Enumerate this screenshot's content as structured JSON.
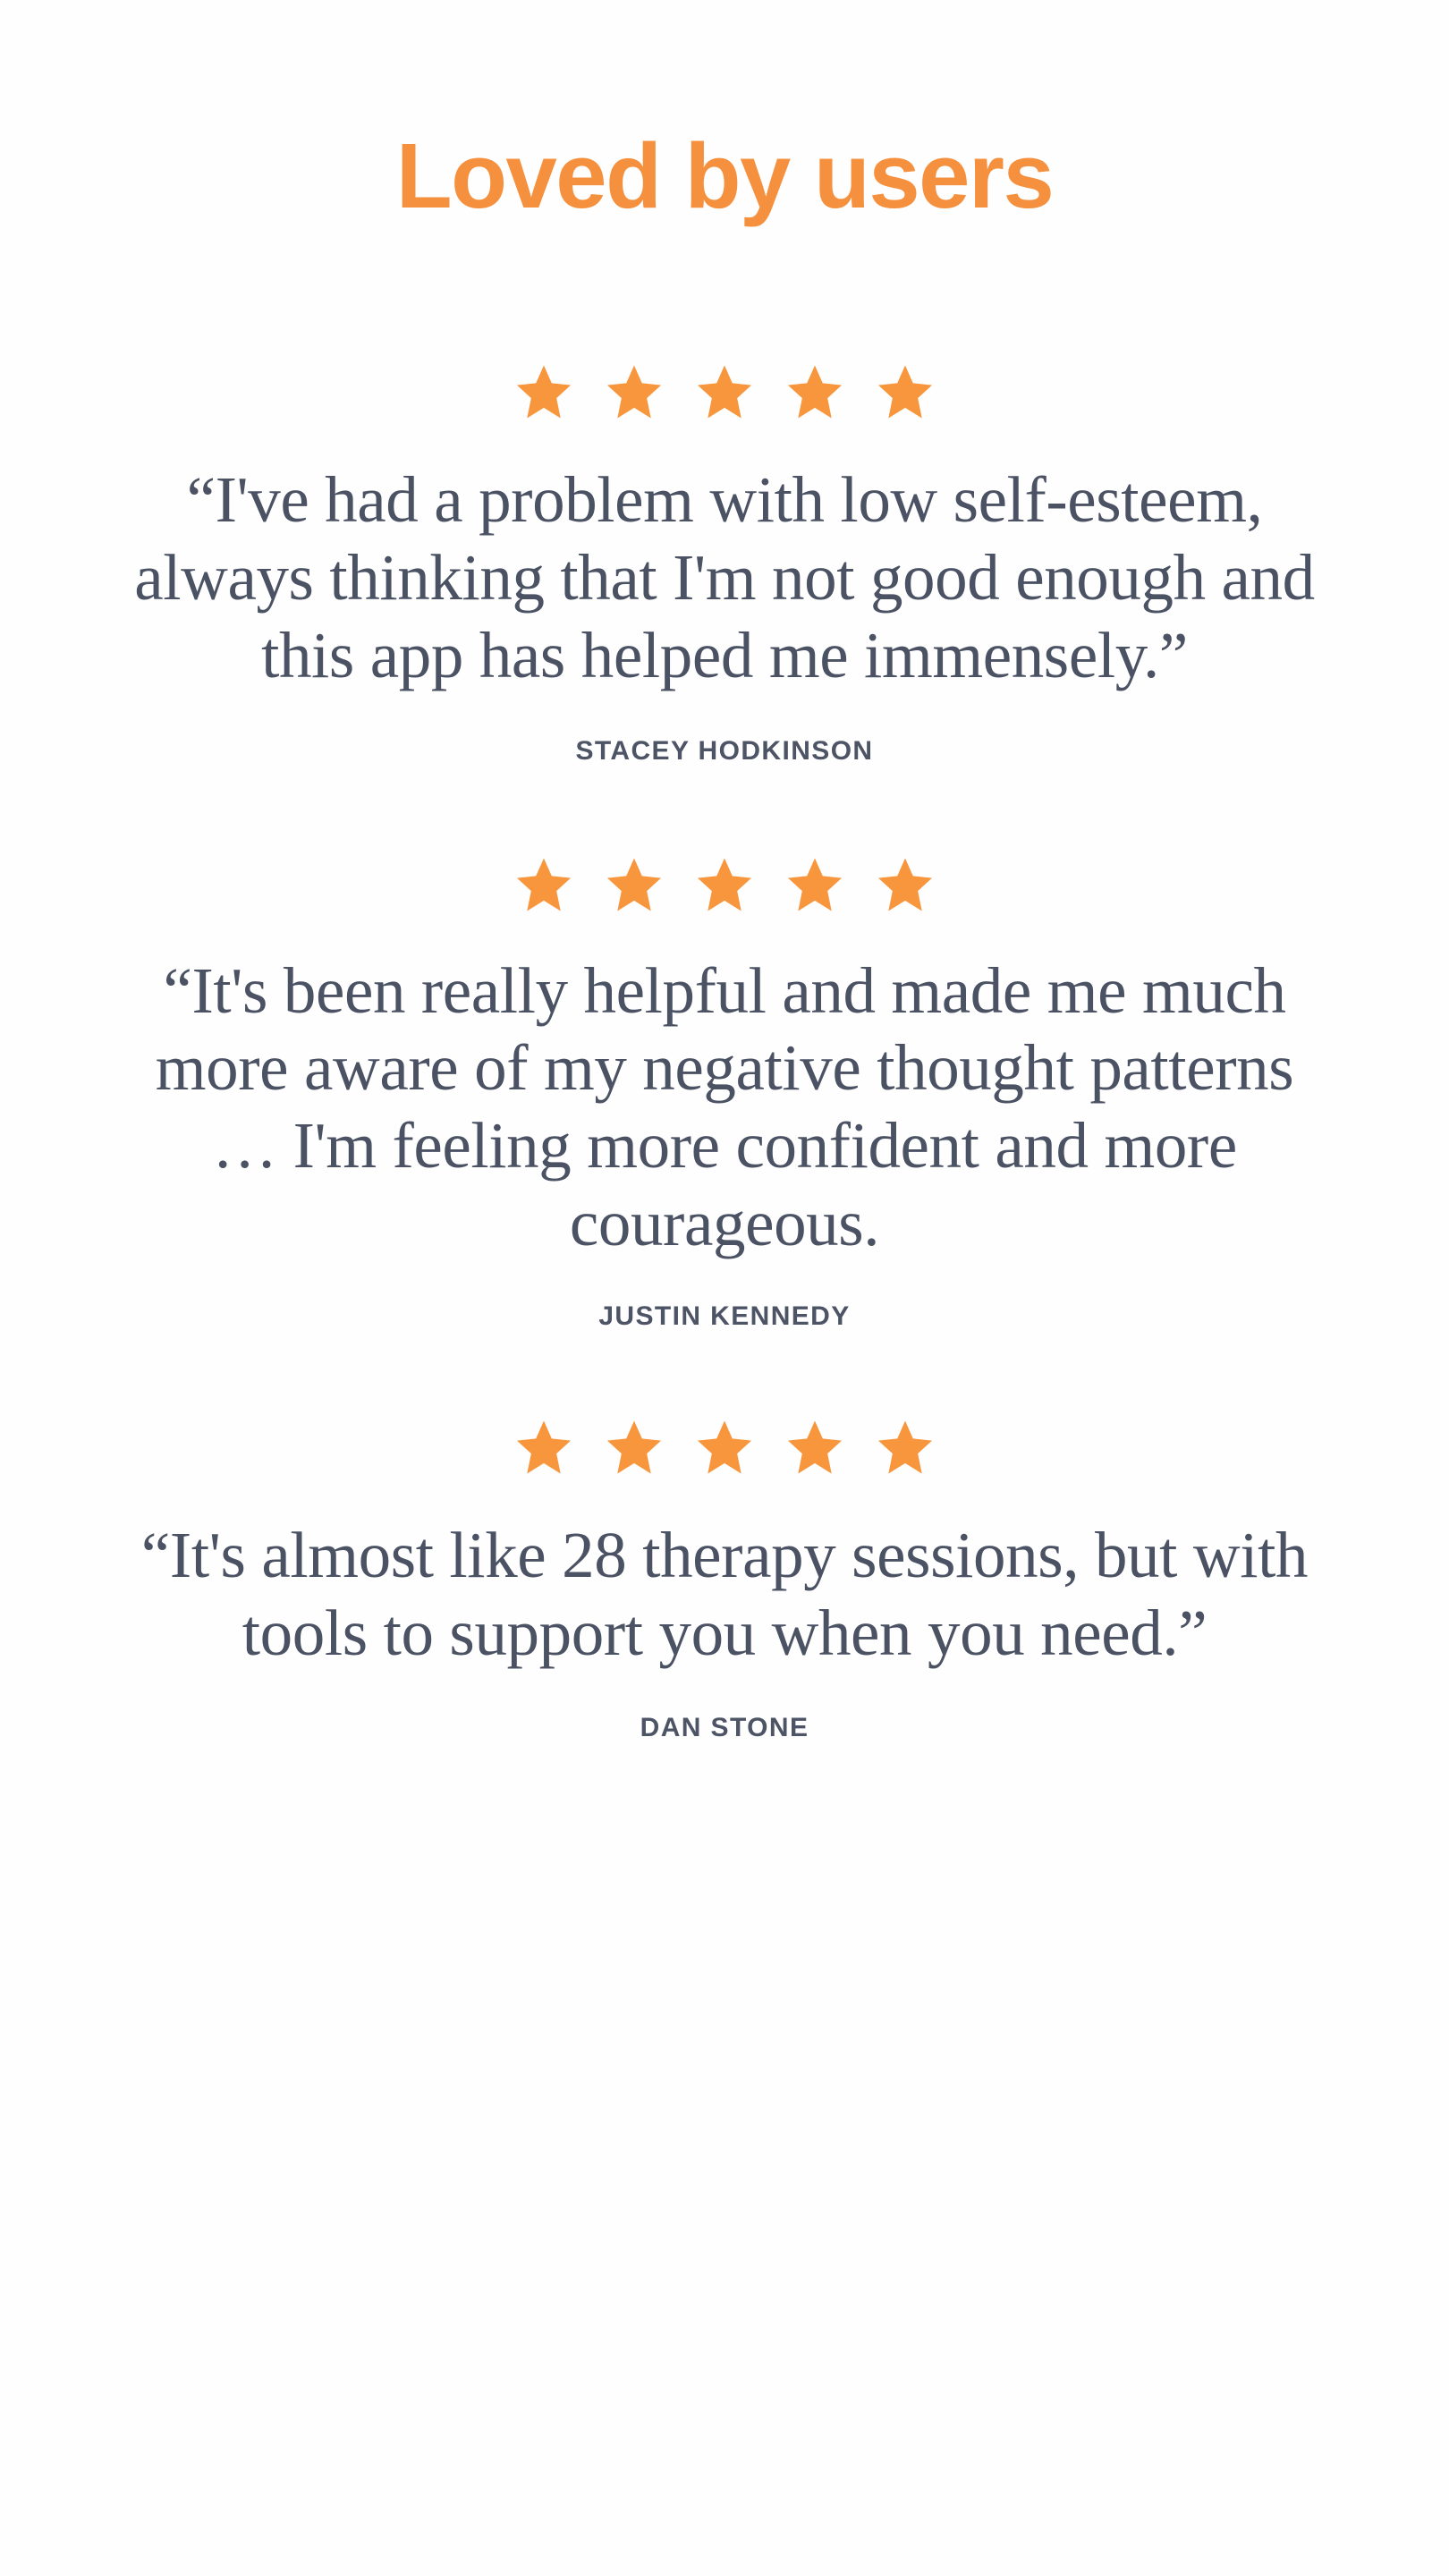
{
  "section": {
    "heading": "Loved by users",
    "accent_color": "#F5913E",
    "star_color": "#F7963C",
    "quote_text_color": "#4A5263",
    "author_text_color": "#4C5465",
    "background_color": "#FFFEFE"
  },
  "stars": {
    "icon_name": "star-icon",
    "count_per_review": 5,
    "rating": 5,
    "max_rating": 5
  },
  "testimonials": [
    {
      "rating": 5,
      "quote": "“I've had a problem with low self-esteem, always thinking that I'm not good enough and this app has helped me immensely.”",
      "author": "STACEY HODKINSON"
    },
    {
      "rating": 5,
      "quote": "“It's been really helpful and made me much more aware of my negative thought patterns … I'm feeling more confident and more courageous.",
      "author": "JUSTIN KENNEDY"
    },
    {
      "rating": 5,
      "quote": "“It's almost like 28 therapy sessions, but with tools to support you when you need.”",
      "author": "DAN STONE"
    }
  ]
}
